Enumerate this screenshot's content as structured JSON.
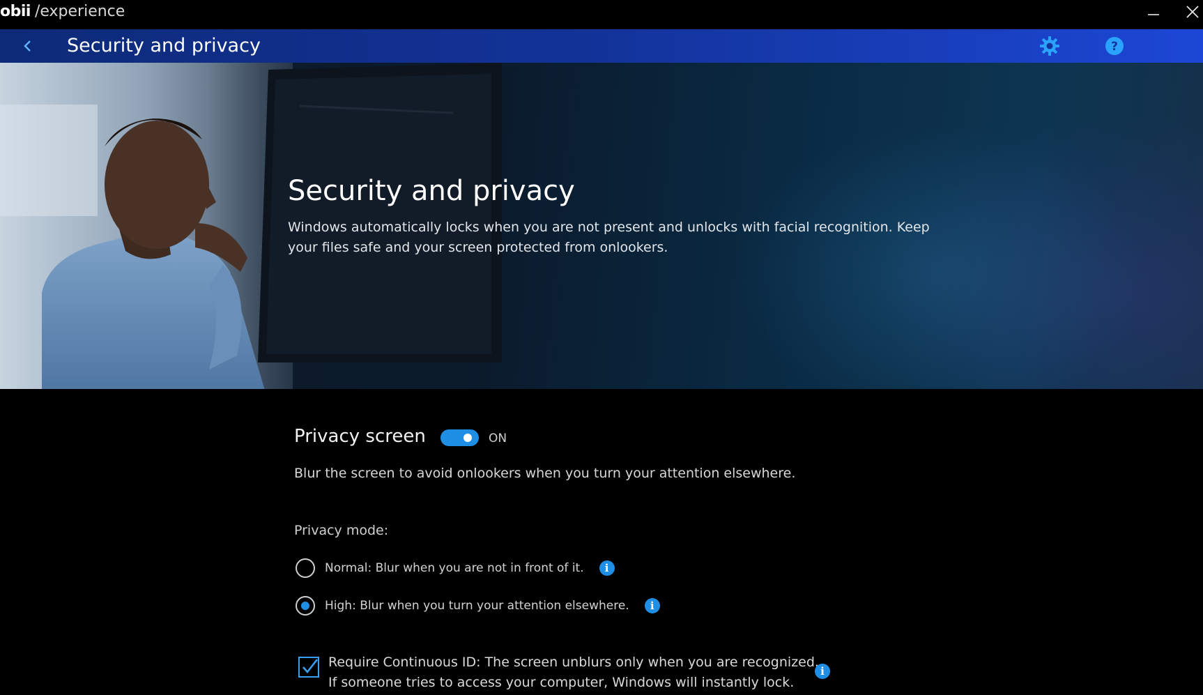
{
  "titlebar": {
    "logo_text": "obii",
    "product_text": "/experience",
    "minimize_icon": "minimize-icon",
    "close_icon": "close-icon"
  },
  "header": {
    "title": "Security and privacy",
    "back_icon": "chevron-left-icon",
    "settings_icon": "gear-icon",
    "help_icon": "help-icon"
  },
  "hero": {
    "title": "Security and privacy",
    "description": "Windows automatically locks when you are not present and unlocks with facial recognition. Keep your files safe and your screen protected from onlookers."
  },
  "privacy_screen": {
    "title": "Privacy screen",
    "toggle_on": true,
    "toggle_state": "ON",
    "description": "Blur the screen to avoid onlookers when you turn your attention elsewhere.",
    "mode_label": "Privacy mode:",
    "modes": [
      {
        "label": "Normal: Blur when you are not in front of it.",
        "selected": false
      },
      {
        "label": "High: Blur when you turn your attention elsewhere.",
        "selected": true
      }
    ],
    "continuous_id": {
      "checked": true,
      "line1": "Require Continuous ID: The screen unblurs only when you are recognized.",
      "line2": "If someone tries to access your computer, Windows will instantly lock."
    },
    "info_glyph": "i"
  },
  "colors": {
    "accent": "#1f8fe6",
    "header_start": "#0d2a78",
    "header_end": "#1c47d6",
    "background": "#000000"
  }
}
